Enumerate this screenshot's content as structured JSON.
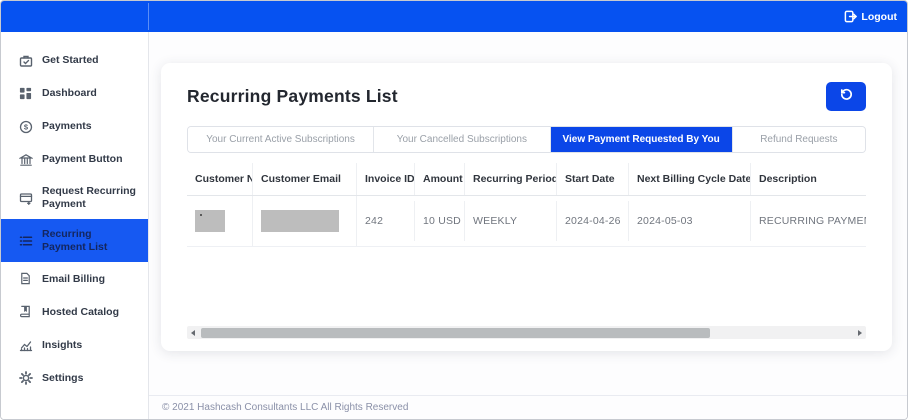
{
  "topbar": {
    "logout_label": "Logout"
  },
  "sidebar": {
    "items": [
      {
        "label": "Get Started",
        "icon": "briefcase-icon",
        "active": false
      },
      {
        "label": "Dashboard",
        "icon": "grid-icon",
        "active": false
      },
      {
        "label": "Payments",
        "icon": "dollar-circle-icon",
        "active": false
      },
      {
        "label": "Payment Button",
        "icon": "bank-icon",
        "active": false
      },
      {
        "label": "Request Recurring Payment",
        "icon": "card-plus-icon",
        "active": false
      },
      {
        "label": "Recurring Payment List",
        "icon": "list-icon",
        "active": true
      },
      {
        "label": "Email Billing",
        "icon": "document-icon",
        "active": false
      },
      {
        "label": "Hosted Catalog",
        "icon": "book-icon",
        "active": false
      },
      {
        "label": "Insights",
        "icon": "chart-icon",
        "active": false
      },
      {
        "label": "Settings",
        "icon": "gear-icon",
        "active": false
      }
    ]
  },
  "main": {
    "title": "Recurring Payments List",
    "refresh_button_icon": "refresh-icon",
    "tabs": [
      {
        "label": "Your Current Active Subscriptions",
        "active": false
      },
      {
        "label": "Your Cancelled Subscriptions",
        "active": false
      },
      {
        "label": "View Payment Requested By You",
        "active": true
      },
      {
        "label": "Refund Requests",
        "active": false
      }
    ],
    "table": {
      "columns": [
        "Customer Name",
        "Customer Email",
        "Invoice ID",
        "Amount",
        "Recurring Period",
        "Start Date",
        "Next Billing Cycle Date",
        "Description"
      ],
      "rows": [
        {
          "customer_name_redacted": true,
          "customer_email_redacted": true,
          "invoice_id": "242",
          "amount": "10 USD",
          "recurring_period": "WEEKLY",
          "start_date": "2024-04-26",
          "next_billing_cycle_date": "2024-05-03",
          "description": "RECURRING PAYMENT"
        }
      ]
    }
  },
  "footer": {
    "copyright": "© 2021 Hashcash Consultants LLC All Rights Reserved"
  },
  "colors": {
    "topbar_blue": "#0652f1",
    "accent_blue": "#0b46e8",
    "active_sidebar_blue": "#1659f2",
    "active_sidebar_text": "#14265e",
    "redacted_gray": "#bdbdbd"
  }
}
